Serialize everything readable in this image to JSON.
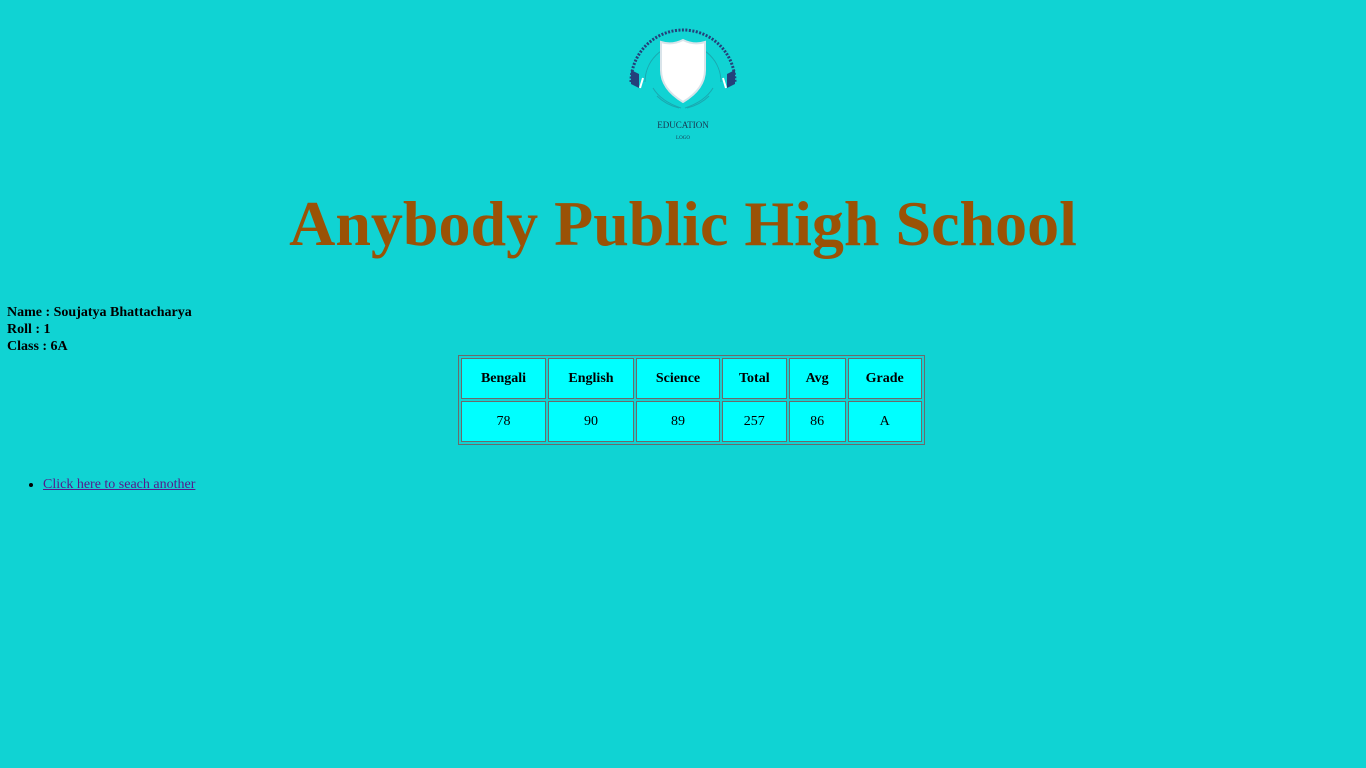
{
  "logo": {
    "text_main": "EDUCATION",
    "text_sub": "LOGO",
    "icon": "shield-icon",
    "colors": {
      "arc": "#24407a",
      "shield": "#ffffff",
      "line": "#1aa8b0"
    }
  },
  "school": {
    "title": "Anybody Public High School",
    "title_color": "#9a5206"
  },
  "student": {
    "name_line": "Name : Soujatya Bhattacharya",
    "roll_line": "Roll : 1",
    "class_line": "Class : 6A"
  },
  "marks": {
    "headers": [
      "Bengali",
      "English",
      "Science",
      "Total",
      "Avg",
      "Grade"
    ],
    "values": [
      "78",
      "90",
      "89",
      "257",
      "86",
      "A"
    ]
  },
  "links": {
    "search_another": "Click here to seach another"
  },
  "colors": {
    "background": "#10d3d3",
    "cell_background": "#00ffff",
    "link": "#551a8b"
  }
}
